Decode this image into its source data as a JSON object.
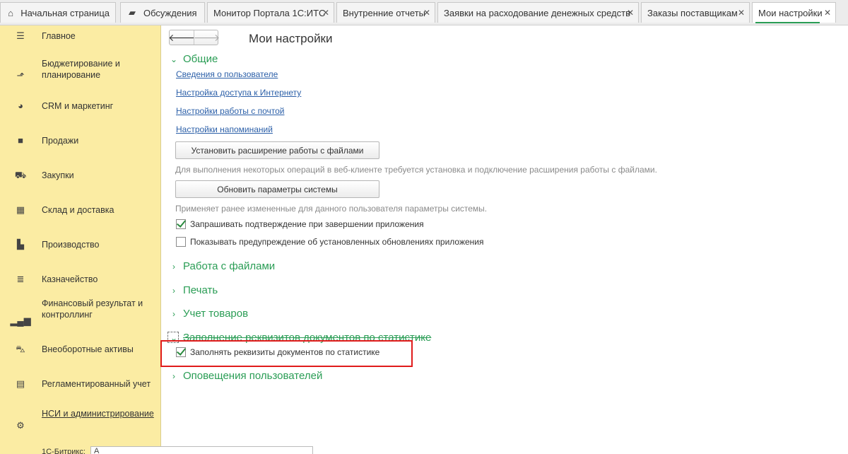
{
  "tabs": [
    {
      "label": "Начальная страница",
      "icon": "home-icon"
    },
    {
      "label": "Обсуждения",
      "icon": "chat-icon"
    },
    {
      "label": "Монитор Портала 1С:ИТС",
      "icon": "close-icon"
    },
    {
      "label": "Внутренние отчеты",
      "icon": "close-icon"
    },
    {
      "label": "Заявки на расходование денежных средств",
      "icon": "close-icon"
    },
    {
      "label": "Заказы поставщикам",
      "icon": "close-icon"
    },
    {
      "label": "Мои настройки",
      "icon": "close-icon",
      "active": true
    }
  ],
  "sidebar": {
    "items": [
      {
        "label": "Главное",
        "icon": "menu-icon"
      },
      {
        "label": "Бюджетирование и планирование",
        "icon": "budget-chart-icon"
      },
      {
        "label": "CRM и маркетинг",
        "icon": "pie-chart-icon"
      },
      {
        "label": "Продажи",
        "icon": "shopping-bag-icon"
      },
      {
        "label": "Закупки",
        "icon": "cart-icon"
      },
      {
        "label": "Склад и доставка",
        "icon": "warehouse-grid-icon"
      },
      {
        "label": "Производство",
        "icon": "factory-icon"
      },
      {
        "label": "Казначейство",
        "icon": "coins-icon"
      },
      {
        "label": "Финансовый результат и контроллинг",
        "icon": "bar-chart-icon"
      },
      {
        "label": "Внеоборотные активы",
        "icon": "truck-icon"
      },
      {
        "label": "Регламентированный учет",
        "icon": "calculator-icon"
      },
      {
        "label": "НСИ и администрирование",
        "icon": "gear-icon"
      }
    ],
    "bottom_label": "1С-Битрикс:",
    "bottom_value": "А"
  },
  "toolbar": {
    "back_icon": "arrow-left-icon",
    "forward_icon": "arrow-right-icon"
  },
  "page": {
    "title": "Мои настройки",
    "group_general": "Общие",
    "link_user_info": "Сведения о пользователе",
    "link_internet": "Настройка доступа к Интернету",
    "link_mail": "Настройки работы с почтой",
    "link_reminders": "Настройки напоминаний",
    "btn_install_ext": "Установить расширение работы с файлами",
    "hint_install_ext": "Для выполнения некоторых операций в веб-клиенте требуется установка и подключение расширения работы с файлами.",
    "btn_update_params": "Обновить параметры системы",
    "hint_update_params": "Применяет ранее измененные для данного пользователя параметры системы.",
    "cb_confirm_exit": {
      "label": "Запрашивать подтверждение при завершении приложения",
      "checked": true
    },
    "cb_show_updates": {
      "label": "Показывать предупреждение об установленных обновлениях приложения",
      "checked": false
    },
    "group_files": "Работа с файлами",
    "group_print": "Печать",
    "group_goods": "Учет товаров",
    "group_autofill": "Заполнение реквизитов документов по статистике",
    "cb_autofill": {
      "label": "Заполнять реквизиты документов по статистике",
      "checked": true
    },
    "group_notifications": "Оповещения пользователей"
  },
  "colors": {
    "accent_green": "#2a9d55",
    "sidebar_bg": "#fbeca3",
    "link_blue": "#2b5fa8",
    "highlight_red": "#e01b1b"
  }
}
